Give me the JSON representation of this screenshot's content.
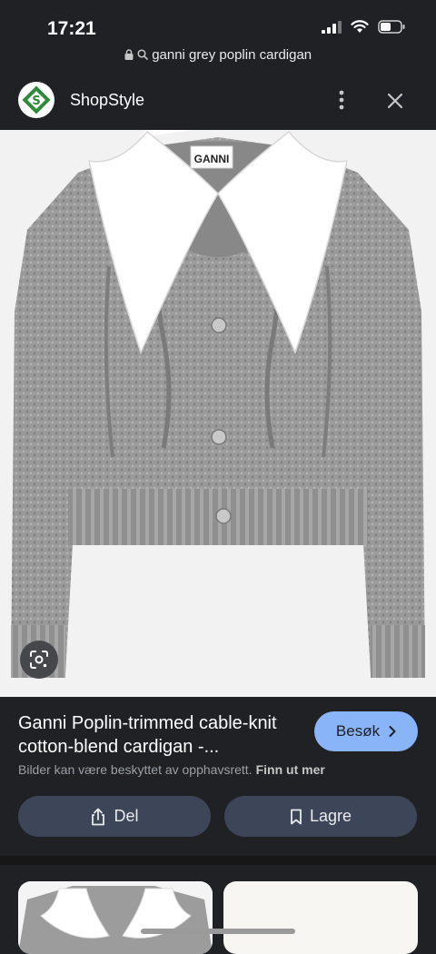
{
  "status_bar": {
    "time": "17:21"
  },
  "browser": {
    "url_query": "ganni grey poplin cardigan"
  },
  "header": {
    "site_name": "ShopStyle"
  },
  "product": {
    "label_brand": "GANNI",
    "title": "Ganni Poplin-trimmed cable-knit cotton-blend cardigan -...",
    "visit_label": "Besøk",
    "copyright_notice": "Bilder kan være beskyttet av opphavsrett.",
    "learn_more_label": "Finn ut mer"
  },
  "actions": {
    "share_label": "Del",
    "save_label": "Lagre"
  },
  "colors": {
    "background": "#202124",
    "accent": "#8ab4f8",
    "action_button": "#3c4658"
  },
  "icons": [
    "signal-icon",
    "wifi-icon",
    "battery-icon",
    "lock-icon",
    "search-icon",
    "shopstyle-logo",
    "more-vert-icon",
    "close-icon",
    "lens-icon",
    "chevron-right-icon",
    "share-icon",
    "bookmark-icon"
  ]
}
